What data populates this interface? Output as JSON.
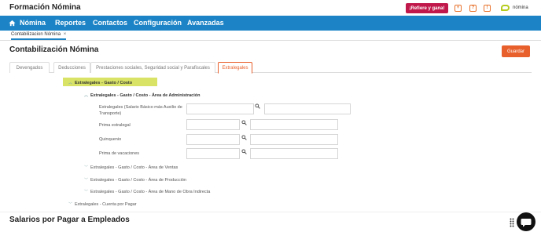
{
  "header": {
    "app_title": "Formación Nómina",
    "refer_label": "¡Refiere y gana!",
    "icons": [
      "plus-icon",
      "help-icon",
      "bell-icon"
    ],
    "logo_text": "nómina"
  },
  "nav": {
    "items": [
      {
        "label": "Nómina"
      },
      {
        "label": "Reportes"
      },
      {
        "label": "Contactos"
      },
      {
        "label": "Configuración"
      },
      {
        "label": "Avanzadas"
      }
    ]
  },
  "breadcrumb": {
    "tab_label": "Contabilizacion Nómina",
    "close": "×"
  },
  "page": {
    "title": "Contabilización Nómina",
    "save_label": "Guardar"
  },
  "tabs": [
    {
      "label": "Devengados",
      "active": false
    },
    {
      "label": "Deducciones",
      "active": false
    },
    {
      "label": "Prestaciones sociales, Seguridad social y Parafiscales",
      "active": false
    },
    {
      "label": "Extralegales",
      "active": true
    }
  ],
  "tree": {
    "root": "Extralegales - Gasto / Costo",
    "group_admin": "Extralegales - Gasto / Costo - Área de Administración",
    "fields": [
      {
        "label": "Extralegales (Salario Básico más Auxilio de Transporte)"
      },
      {
        "label": "Prima extralegal"
      },
      {
        "label": "Quinquenio"
      },
      {
        "label": "Prima de vacaciones"
      }
    ],
    "group_ventas": "Extralegales - Gasto / Costo - Área de Ventas",
    "group_produccion": "Extralegales - Gasto / Costo - Área de Producción",
    "group_indirecta": "Extralegales - Gasto / Costo - Área de Mano de Obra Indirecta",
    "cuenta_por_pagar": "Extralegales - Cuenta por Pagar"
  },
  "section2": {
    "title": "Salarios por Pagar a Empleados"
  },
  "colors": {
    "nav_blue": "#1c84c6",
    "accent_orange": "#e8602c",
    "refer_red": "#c0184a",
    "highlight_yellow": "#d9e466"
  }
}
